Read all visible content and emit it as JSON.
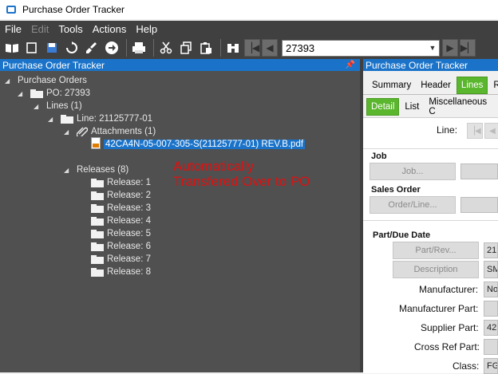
{
  "window": {
    "title": "Purchase Order Tracker"
  },
  "menu": {
    "items": [
      "File",
      "Edit",
      "Tools",
      "Actions",
      "Help"
    ]
  },
  "toolbar": {
    "po_number": "27393"
  },
  "left_panel": {
    "title": "Purchase Order Tracker",
    "tree": {
      "root": "Purchase Orders",
      "po": "PO: 27393",
      "lines": "Lines (1)",
      "line": "Line: 21125777-01",
      "attachments": "Attachments (1)",
      "attachment_file": "42CA4N-05-007-305-S(21125777-01) REV.B.pdf",
      "releases": "Releases (8)",
      "release_items": [
        "Release: 1",
        "Release: 2",
        "Release: 3",
        "Release: 4",
        "Release: 5",
        "Release: 6",
        "Release: 7",
        "Release: 8"
      ]
    },
    "annotation_line1": "Automatically",
    "annotation_line2": "Transfered Over to PO"
  },
  "right_panel": {
    "title": "Purchase Order Tracker",
    "tabs": [
      "Summary",
      "Header",
      "Lines",
      "R"
    ],
    "subtabs": [
      "Detail",
      "List",
      "Miscellaneous C"
    ],
    "line_label": "Line:",
    "job_section": "Job",
    "job_button": "Job...",
    "sales_order_section": "Sales Order",
    "order_line_button": "Order/Line...",
    "part_due_section": "Part/Due Date",
    "part_rev_button": "Part/Rev...",
    "part_rev_value": "21",
    "description_button": "Description",
    "description_value": "SM",
    "manufacturer_label": "Manufacturer:",
    "manufacturer_value": "No",
    "manufacturer_part_label": "Manufacturer Part:",
    "supplier_part_label": "Supplier Part:",
    "supplier_part_value": "42",
    "cross_ref_label": "Cross Ref Part:",
    "class_label": "Class:",
    "class_value": "FG"
  }
}
